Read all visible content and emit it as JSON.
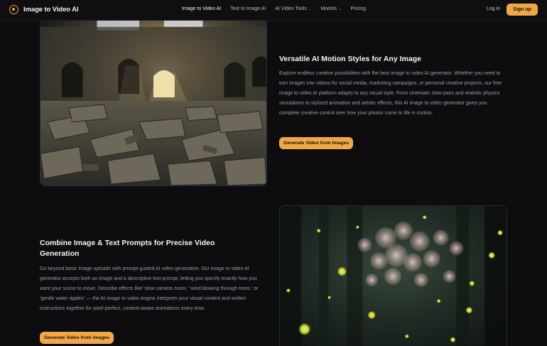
{
  "nav": {
    "brand": "Image to Video AI",
    "links": [
      {
        "label": "Image to Video AI"
      },
      {
        "label": "Text to Image AI"
      },
      {
        "label": "AI Video Tools"
      },
      {
        "label": "Models"
      },
      {
        "label": "Pricing"
      }
    ],
    "login": "Log in",
    "signup": "Sign up"
  },
  "section1": {
    "heading": "Versatile AI Motion Styles for Any Image",
    "body": "Explore endless creative possibilities with the best image to video AI generator. Whether you need to turn images into videos for social media, marketing campaigns, or personal creative projects, our free image to video AI platform adapts to any visual style. From cinematic slow pans and realistic physics simulations to stylized animation and artistic effects, this AI image to video generator gives you complete creative control over how your photos come to life in motion.",
    "cta": "Generate Video from Images"
  },
  "section2": {
    "heading": "Combine Image & Text Prompts for Precise Video Generation",
    "body": "Go beyond basic image uploads with prompt-guided AI video generation. Our image to video AI generator accepts both an image and a descriptive text prompt, letting you specify exactly how you want your scene to move. Describe effects like 'slow camera zoom,' 'wind blowing through trees,' or 'gentle water ripples' — the AI image to video engine interprets your visual content and written instructions together for pixel-perfect, context-aware animations every time.",
    "cta": "Generate Video from Images"
  },
  "colors": {
    "accent": "#f0a847",
    "background": "#0d0d10"
  }
}
